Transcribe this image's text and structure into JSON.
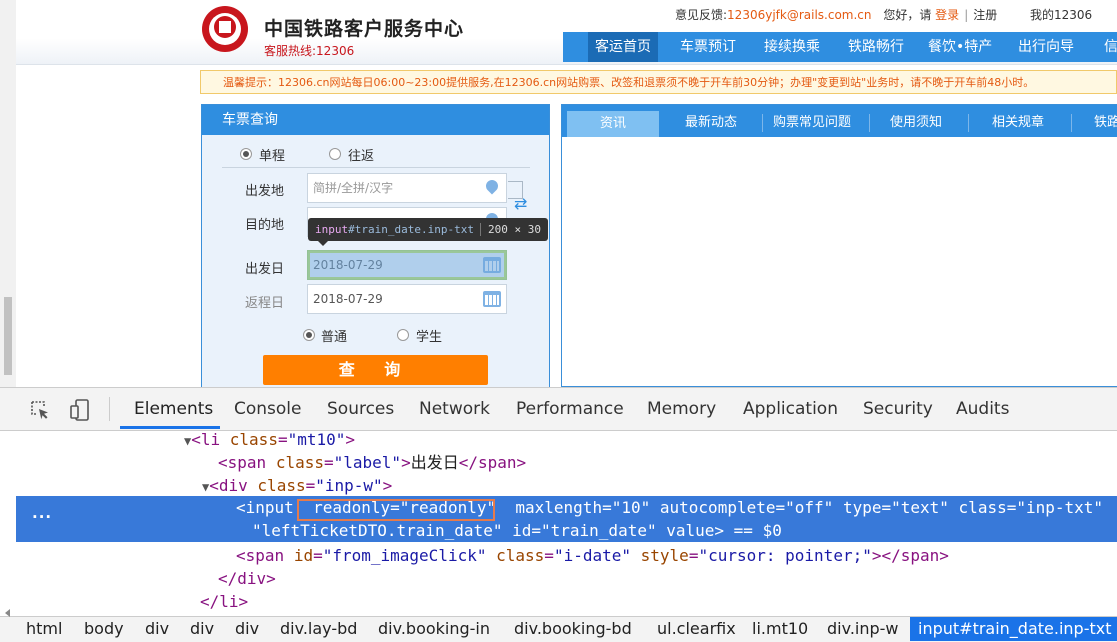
{
  "header": {
    "site_title": "中国铁路客户服务中心",
    "hotline": "客服热线:12306",
    "feedback_label": "意见反馈:",
    "feedback_email": "12306yjfk@rails.com.cn",
    "greeting": "您好，请",
    "login": "登录",
    "separator": "|",
    "register": "注册",
    "my_account": "我的12306"
  },
  "nav": {
    "items": [
      "客运首页",
      "车票预订",
      "接续换乘",
      "铁路畅行",
      "餐饮•特产",
      "出行向导",
      "信"
    ]
  },
  "tip": "温馨提示：12306.cn网站每日06:00~23:00提供服务,在12306.cn网站购票、改签和退票须不晚于开车前30分钟；办理\"变更到站\"业务时，请不晚于开车前48小时。",
  "booking": {
    "title": "车票查询",
    "trip_single": "单程",
    "trip_round": "往返",
    "from_label": "出发地",
    "from_placeholder": "简拼/全拼/汉字",
    "to_label": "目的地",
    "depart_label": "出发日",
    "depart_value": "2018-07-29",
    "return_label": "返程日",
    "return_value": "2018-07-29",
    "type_normal": "普通",
    "type_student": "学生",
    "search_button": "查 询"
  },
  "news": {
    "tabs": [
      "资讯",
      "最新动态",
      "购票常见问题",
      "使用须知",
      "相关规章",
      "铁路"
    ]
  },
  "inspect_tooltip": {
    "tag": "input",
    "selector": "#train_date.inp-txt",
    "size": "200 × 30"
  },
  "devtools": {
    "tabs": [
      "Elements",
      "Console",
      "Sources",
      "Network",
      "Performance",
      "Memory",
      "Application",
      "Security",
      "Audits"
    ],
    "active_tab": "Elements",
    "ellipsis": "...",
    "code": {
      "li_open": {
        "tag": "li",
        "attr": "class",
        "value": "\"mt10\""
      },
      "span_label": {
        "tag": "span",
        "attr": "class",
        "value": "\"label\"",
        "text": "出发日"
      },
      "div_open": {
        "tag": "div",
        "attr": "class",
        "value": "\"inp-w\""
      },
      "input_line1": {
        "tag": "input",
        "readonly_attr": "readonly",
        "readonly_val": "\"readonly\"",
        "maxlength_attr": "maxlength",
        "maxlength_val": "\"10\"",
        "autocomplete_attr": "autocomplete",
        "autocomplete_val": "\"off\"",
        "type_attr": "type",
        "type_val": "\"text\"",
        "class_attr": "class",
        "class_val": "\"inp-txt\""
      },
      "input_line2": {
        "name_val": "\"leftTicketDTO.train_date\"",
        "id_attr": "id",
        "id_val": "\"train_date\"",
        "value_attr": "value",
        "dollar": "== $0"
      },
      "span_img": {
        "id_val": "\"from_imageClick\"",
        "class_val": "\"i-date\"",
        "style_val": "\"cursor: pointer;\""
      },
      "div_close": "</div>",
      "li_close": "</li>"
    },
    "breadcrumb": [
      "html",
      "body",
      "div",
      "div",
      "div",
      "div.lay-bd",
      "div.booking-in",
      "div.booking-bd",
      "ul.clearfix",
      "li.mt10",
      "div.inp-w",
      "input#train_date.inp-txt"
    ]
  },
  "colors": {
    "brand_blue": "#2f8ee0",
    "brand_red": "#c8161d",
    "search_orange": "#ff7f00",
    "devtools_selection": "#3879d9",
    "devtools_accent": "#1a73e8"
  }
}
